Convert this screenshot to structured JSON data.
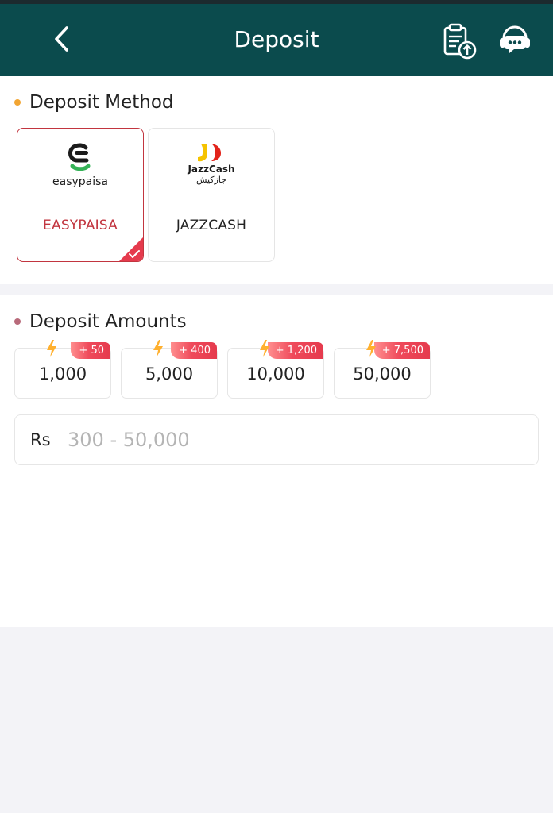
{
  "header": {
    "title": "Deposit",
    "back_icon": "chevron-left-icon",
    "records_icon": "clipboard-upload-icon",
    "support_icon": "headset-icon",
    "background": "#0b4b4d"
  },
  "deposit_method": {
    "title": "Deposit Method",
    "dot_color": "#f2a532",
    "methods": [
      {
        "logo_text": "easypaisa",
        "name": "EASYPAISA",
        "selected": true
      },
      {
        "logo_text": "JazzCash",
        "logo_subtext": "جازکیش",
        "name": "JAZZCASH",
        "selected": false
      }
    ]
  },
  "deposit_amounts": {
    "title": "Deposit Amounts",
    "dot_color": "#b86a7a",
    "options": [
      {
        "amount": "1,000",
        "bonus": "+ 50"
      },
      {
        "amount": "5,000",
        "bonus": "+ 400"
      },
      {
        "amount": "10,000",
        "bonus": "+ 1,200"
      },
      {
        "amount": "50,000",
        "bonus": "+ 7,500"
      }
    ],
    "currency_label": "Rs",
    "input_placeholder": "300 - 50,000",
    "input_value": ""
  },
  "colors": {
    "accent_red": "#c2353f",
    "easypaisa_green": "#35b257"
  }
}
